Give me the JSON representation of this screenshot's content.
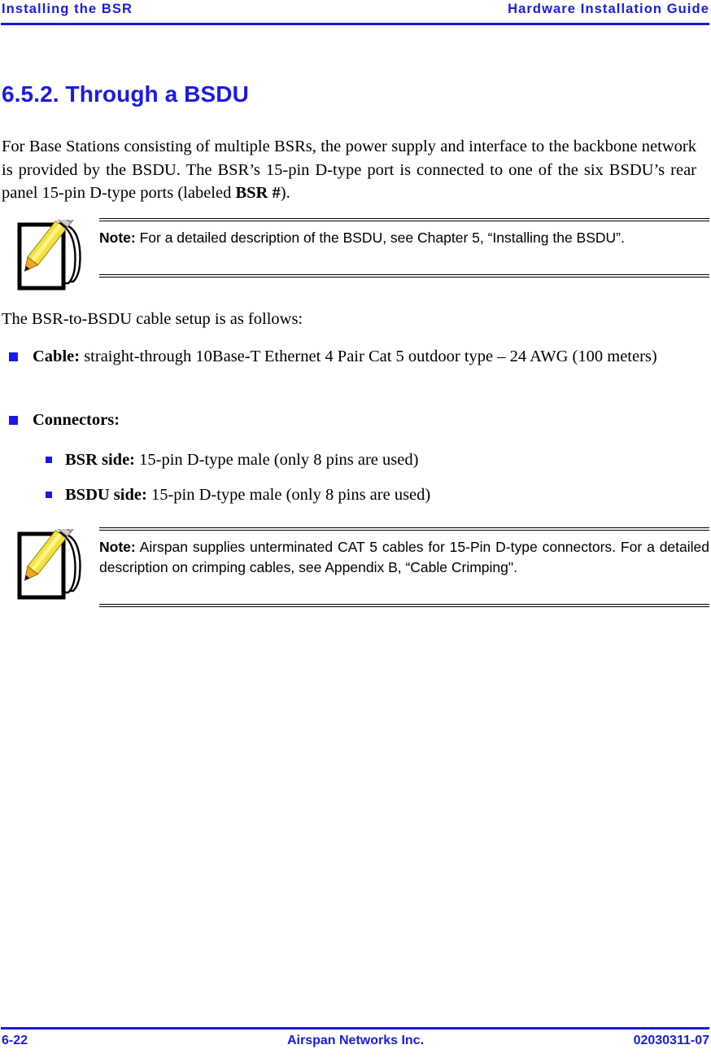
{
  "header": {
    "left_text": "Installing the BSR",
    "right_text": "Hardware Installation Guide",
    "rule_color": "#1a1ae6"
  },
  "section": {
    "heading": "6.5.2. Through a BSDU"
  },
  "paragraphs": {
    "intro_part1": "For Base Stations consisting of multiple BSRs, the power supply and interface to the backbone network is provided by the BSDU. The BSR’s 15-pin D-type port is connected to one of the six BSDU’s rear panel 15-pin D-type ports (labeled ",
    "intro_bold": "BSR #",
    "intro_part2": ").",
    "cable_setup_lead": "The BSR-to-BSDU cable setup is as follows:"
  },
  "notes": [
    {
      "icon": "notepad-pencil-icon",
      "label": "Note:",
      "text": "  For a detailed description of the BSDU, see Chapter 5, “Installing the BSDU”."
    },
    {
      "icon": "notepad-pencil-icon",
      "label": "Note:",
      "text": "  Airspan supplies unterminated CAT 5 cables for 15-Pin D-type connectors. For a detailed description on crimping cables, see Appendix B, “Cable Crimping\"."
    }
  ],
  "bullets": {
    "cable": {
      "label": "Cable:",
      "text": " straight-through 10Base-T Ethernet 4 Pair Cat 5 outdoor type – 24 AWG (100 meters)"
    },
    "connectors": {
      "label": "Connectors:",
      "text": ""
    },
    "bsr_side": {
      "label": "BSR side:",
      "text": " 15-pin D-type male (only 8 pins are used)"
    },
    "bsdu_side": {
      "label": "BSDU side:",
      "text": " 15-pin D-type male (only 8 pins are used)"
    },
    "bullet_color": "#1a1ae6"
  },
  "footer": {
    "page_number": "6-22",
    "company": "Airspan Networks Inc.",
    "doc_number": "02030311-07",
    "rule_color": "#1a1ae6"
  }
}
